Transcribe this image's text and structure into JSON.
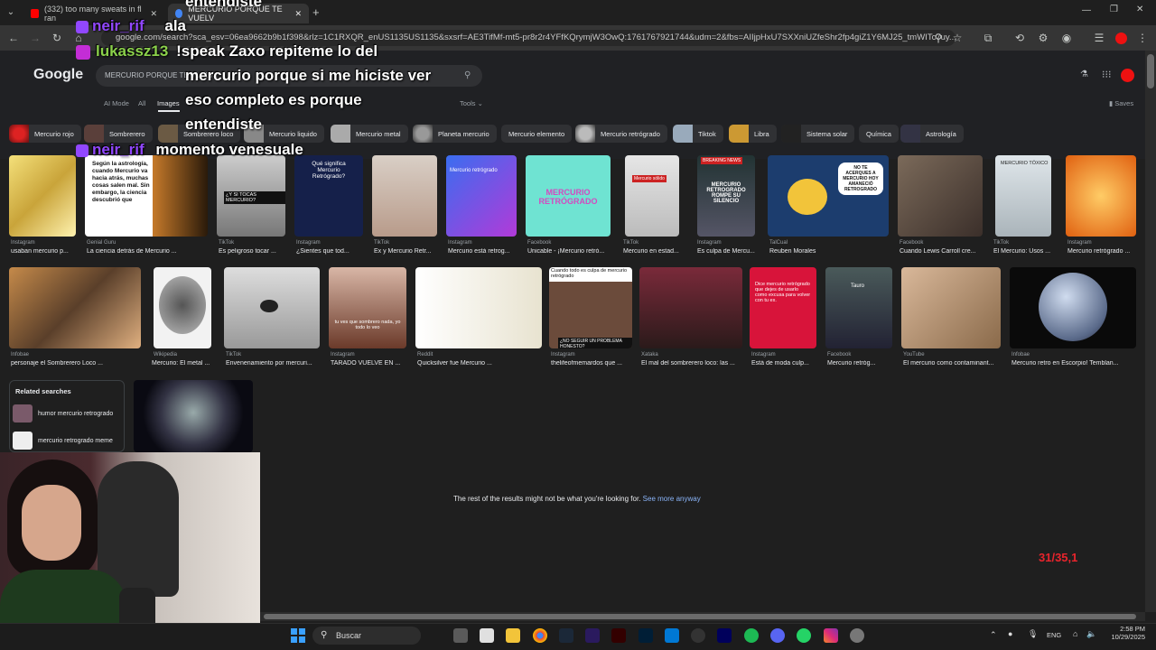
{
  "browser": {
    "tabs": [
      {
        "title": "(332) too many sweats in fl ran",
        "active": false
      },
      {
        "title": "MERCURIO PORQUE TE VUELV",
        "active": true
      }
    ],
    "new_tab": "+",
    "url": "google.com/search?sca_esv=06ea9662b9b1f398&rlz=1C1RXQR_enUS1135US1135&sxsrf=AE3TifMf-mt5-pr8r2r4YFfKQrymjW3OwQ:1761767921744&udm=2&fbs=AIIjpHxU7SXXniUZfeShr2fp4giZ1Y6MJ25_tmWITc7uy..."
  },
  "google": {
    "logo": "Google",
    "search_text": "MERCURIO PORQUE TE VUELVE",
    "nav": [
      "AI Mode",
      "All",
      "Images"
    ],
    "tools": "Tools",
    "saves": "Saves",
    "chips": [
      "Mercurio rojo",
      "Sombrerero",
      "Sombrerero loco",
      "Mercurio liquido",
      "Mercurio metal",
      "Planeta mercurio",
      "Mercurio elemento",
      "Mercurio retrógrado",
      "Tiktok",
      "Libra",
      "Sistema solar",
      "Química",
      "Astrología"
    ],
    "row1": [
      {
        "src": "Instagram",
        "cap": "usaban mercurio p..."
      },
      {
        "src": "Genial Guru",
        "cap": "La ciencia detrás de Mercurio ..."
      },
      {
        "src": "TikTok",
        "cap": "Es peligroso tocar ..."
      },
      {
        "src": "Instagram",
        "cap": "¿Sientes que tod..."
      },
      {
        "src": "TikTok",
        "cap": "Ex y Mercurio Retr..."
      },
      {
        "src": "Instagram",
        "cap": "Mercurio está retrog..."
      },
      {
        "src": "Facebook",
        "cap": "Unicable - ¡Mercurio retró..."
      },
      {
        "src": "TikTok",
        "cap": "Mercurio en estad..."
      },
      {
        "src": "Instagram",
        "cap": "Es culpa de Mercu..."
      },
      {
        "src": "TalCual",
        "cap": "Reuben Morales"
      },
      {
        "src": "Facebook",
        "cap": "Cuando Lewis Carroll cre..."
      },
      {
        "src": "TikTok",
        "cap": "El Mercurio: Usos ..."
      },
      {
        "src": "Instagram",
        "cap": "Mercurio retrógrado ..."
      }
    ],
    "row1_texts": {
      "astro": "Según la astrología, cuando Mercurio va hacia atrás, muchas cosas salen mal. Sin embargo, la ciencia descubrió que",
      "tocas": "¿Y SI TOCAS MERCURIO?",
      "significa": "Qué significa Mercurio Retrógrado?",
      "retro_card": "Mercurio retrógrado",
      "mercurio_retrogrado": "MERCURIO RETRÓGRADO",
      "solido": "Mercurio sólido",
      "breaking": "BREAKING NEWS",
      "rompe": "MERCURIO RETROGRADO ROMPE SU SILENCIO",
      "cartoon_bubble": "NO TE ACERQUES A MERCURIO HOY AMANECIÓ RETROGRADO",
      "toxico": "MERCURIO TÓXICO"
    },
    "row2": [
      {
        "src": "Infobae",
        "cap": "personaje el Sombrerero Loco ..."
      },
      {
        "src": "Wikipedia",
        "cap": "Mercurio: El metal ..."
      },
      {
        "src": "TikTok",
        "cap": "Envenenamiento por mercuri..."
      },
      {
        "src": "Instagram",
        "cap": "TARADO VUELVE EN ..."
      },
      {
        "src": "Reddit",
        "cap": "Quicksilver fue Mercurio ..."
      },
      {
        "src": "Instagram",
        "cap": "thelifeofmemardos que ..."
      },
      {
        "src": "Xataka",
        "cap": "El mal del sombrerero loco: las ..."
      },
      {
        "src": "Instagram",
        "cap": "Está de moda culp..."
      },
      {
        "src": "Facebook",
        "cap": "Mercurio retróg..."
      },
      {
        "src": "YouTube",
        "cap": "El mercurio como contaminant..."
      },
      {
        "src": "Infobae",
        "cap": "Mercurio retro en Escorpio! Temblan..."
      }
    ],
    "row2_texts": {
      "selena": "tu ves que sombrero nada, yo todo lo veo",
      "culpa": "Cuando todo es culpa de mercurio retrógrado",
      "problema": "¿NO SEGUIR UN PROBLEMA HONESTO?",
      "red_card": "Dice mercurio retrógrado que dejes de usarlo como excusa para volver con tu ex.",
      "tauro": "Tauro"
    },
    "related_title": "Related searches",
    "related": [
      "humor mercurio retrogrado",
      "mercurio retrogrado meme"
    ],
    "rest_text": "The rest of the results might not be what you're looking for.",
    "see_more": "See more anyway"
  },
  "chat": [
    {
      "name": "",
      "text": "entendiste"
    },
    {
      "name": "neir_rif",
      "text": "ala"
    },
    {
      "name": "lukassz13",
      "text": "!speak Zaxo repiteme lo del"
    },
    {
      "name": "",
      "text": "mercurio porque si me hiciste ver"
    },
    {
      "name": "",
      "text": "eso completo es porque"
    },
    {
      "name": "",
      "text": "entendiste"
    },
    {
      "name": "neir_rif",
      "text": "momento venesuale"
    }
  ],
  "overlay_counter": "31/35,1",
  "taskbar": {
    "search": "Buscar",
    "lang": "ENG",
    "time": "2:58 PM",
    "date": "10/29/2025"
  },
  "colors": {
    "accent_blue": "#8ab4f8",
    "counter_red": "#e8242c",
    "chat_purple": "#9147ff",
    "chat_green": "#8bd14b"
  }
}
